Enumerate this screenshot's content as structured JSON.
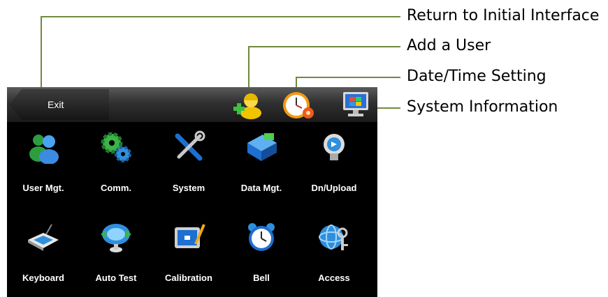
{
  "callouts": {
    "return_initial": "Return to Initial Interface",
    "add_user": "Add a User",
    "date_time": "Date/Time Setting",
    "system_info": "System Information"
  },
  "topbar": {
    "exit_label": "Exit"
  },
  "menu": {
    "items": [
      {
        "label": "User Mgt.",
        "icon": "users-icon"
      },
      {
        "label": "Comm.",
        "icon": "gears-icon"
      },
      {
        "label": "System",
        "icon": "tools-icon"
      },
      {
        "label": "Data Mgt.",
        "icon": "data-folder-icon"
      },
      {
        "label": "Dn/Upload",
        "icon": "usb-drive-icon"
      },
      {
        "label": "Keyboard",
        "icon": "keyboard-icon"
      },
      {
        "label": "Auto Test",
        "icon": "monitor-test-icon"
      },
      {
        "label": "Calibration",
        "icon": "calibration-icon"
      },
      {
        "label": "Bell",
        "icon": "alarm-bell-icon"
      },
      {
        "label": "Access",
        "icon": "access-keys-icon"
      }
    ]
  },
  "colors": {
    "callout_line": "#6f8a3e",
    "screen_bg": "#000000",
    "label_text": "#ffffff"
  }
}
